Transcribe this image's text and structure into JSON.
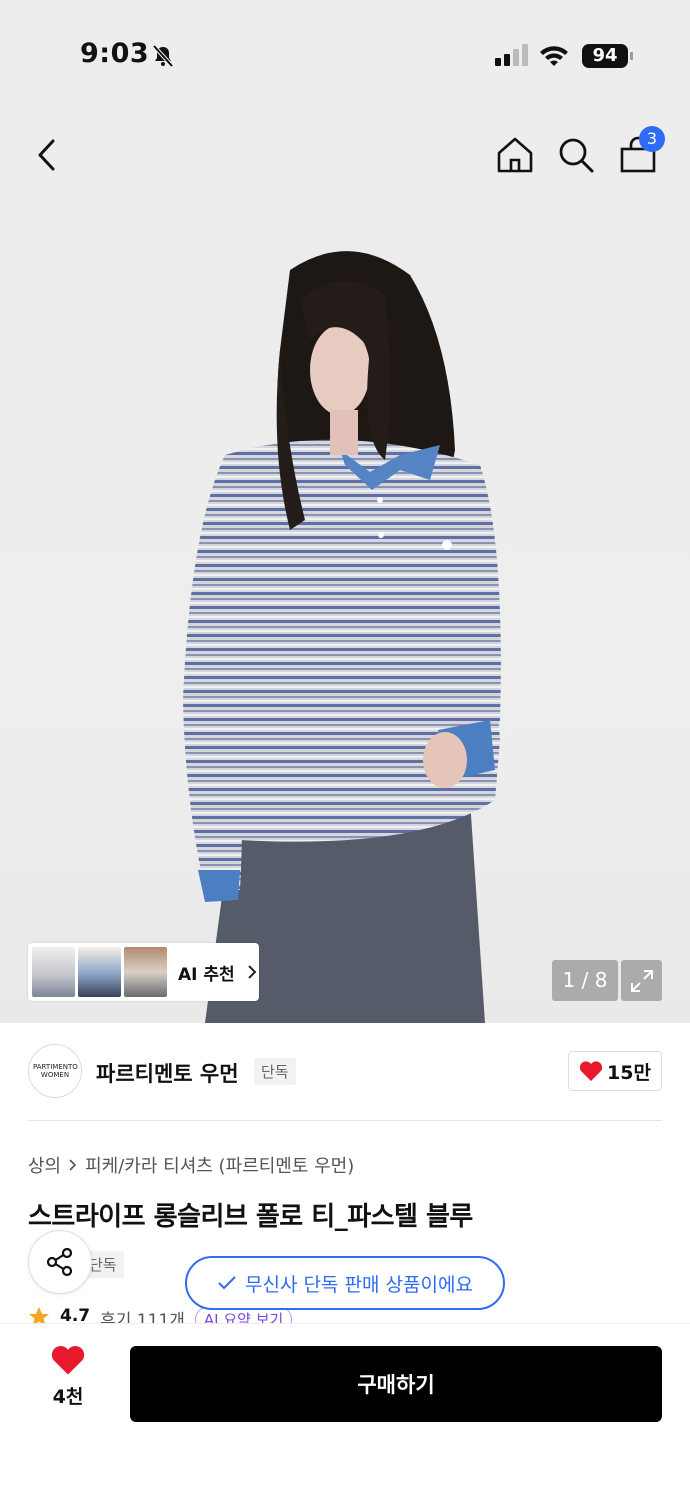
{
  "status_bar": {
    "time": "9:03",
    "battery": "94"
  },
  "nav": {
    "cart_count": "3"
  },
  "gallery": {
    "ai_recommend_label": "AI 추천",
    "counter": "1 / 8"
  },
  "brand": {
    "logo_text": "PARTIMENTO WOMEN",
    "name": "파르티멘토 우먼",
    "tag": "단독",
    "likes": "15만"
  },
  "product": {
    "breadcrumb_category": "상의",
    "breadcrumb_sub": "피케/카라 티셔츠 (파르티멘토 우먼)",
    "title": "스트라이프 롱슬리브 폴로 티_파스텔 블루",
    "tag": "단독",
    "exclusive_notice": "무신사 단독 판매 상품이에요",
    "rating": "4.7",
    "reviews": "후기 111개",
    "ai_summary": "AI 요약 보기"
  },
  "bottom_bar": {
    "wish_count": "4천",
    "buy_label": "구매하기"
  },
  "colors": {
    "accent_blue": "#2f6bf4",
    "heart_red": "#e8192c",
    "ai_purple": "#7b45e6"
  }
}
